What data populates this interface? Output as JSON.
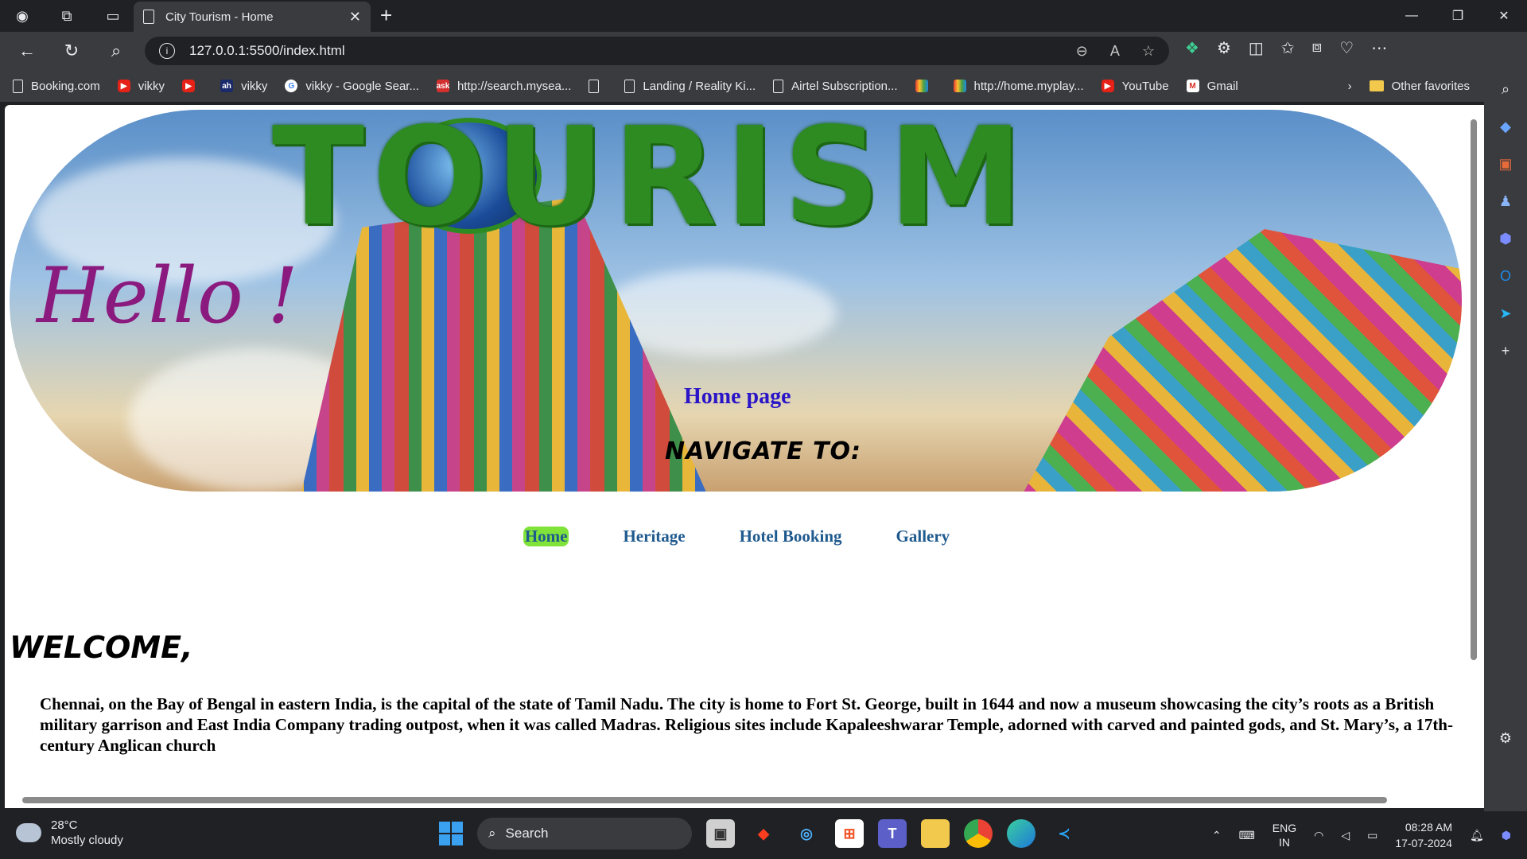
{
  "browser": {
    "tab_title": "City Tourism - Home",
    "url": "127.0.0.1:5500/index.html"
  },
  "bookmarks": [
    "Booking.com",
    "vikky",
    "vikky",
    "vikky - Google Sear...",
    "http://search.mysea...",
    "Landing / Reality Ki...",
    "Airtel Subscription...",
    "http://home.myplay...",
    "YouTube",
    "Gmail"
  ],
  "bookmarks_other": "Other favorites",
  "page": {
    "hero_title": "TOURISM",
    "greeting": "Hello !",
    "hero_subtitle": "Home page",
    "navigate_label": "NAVIGATE TO:",
    "menu": [
      "Home",
      "Heritage",
      "Hotel Booking",
      "Gallery"
    ],
    "welcome": "WELCOME,",
    "paragraph": "Chennai, on the Bay of Bengal in eastern India, is the capital of the state of Tamil Nadu. The city is home to Fort St. George, built in 1644 and now a museum showcasing the city’s roots as a British military garrison and East India Company trading outpost, when it was called Madras. Religious sites include Kapaleeshwarar Temple, adorned with carved and painted gods, and St. Mary’s, a 17th-century Anglican church"
  },
  "taskbar": {
    "temp": "28°C",
    "weather": "Mostly cloudy",
    "search": "Search",
    "lang1": "ENG",
    "lang2": "IN",
    "time": "08:28 AM",
    "date": "17-07-2024"
  }
}
